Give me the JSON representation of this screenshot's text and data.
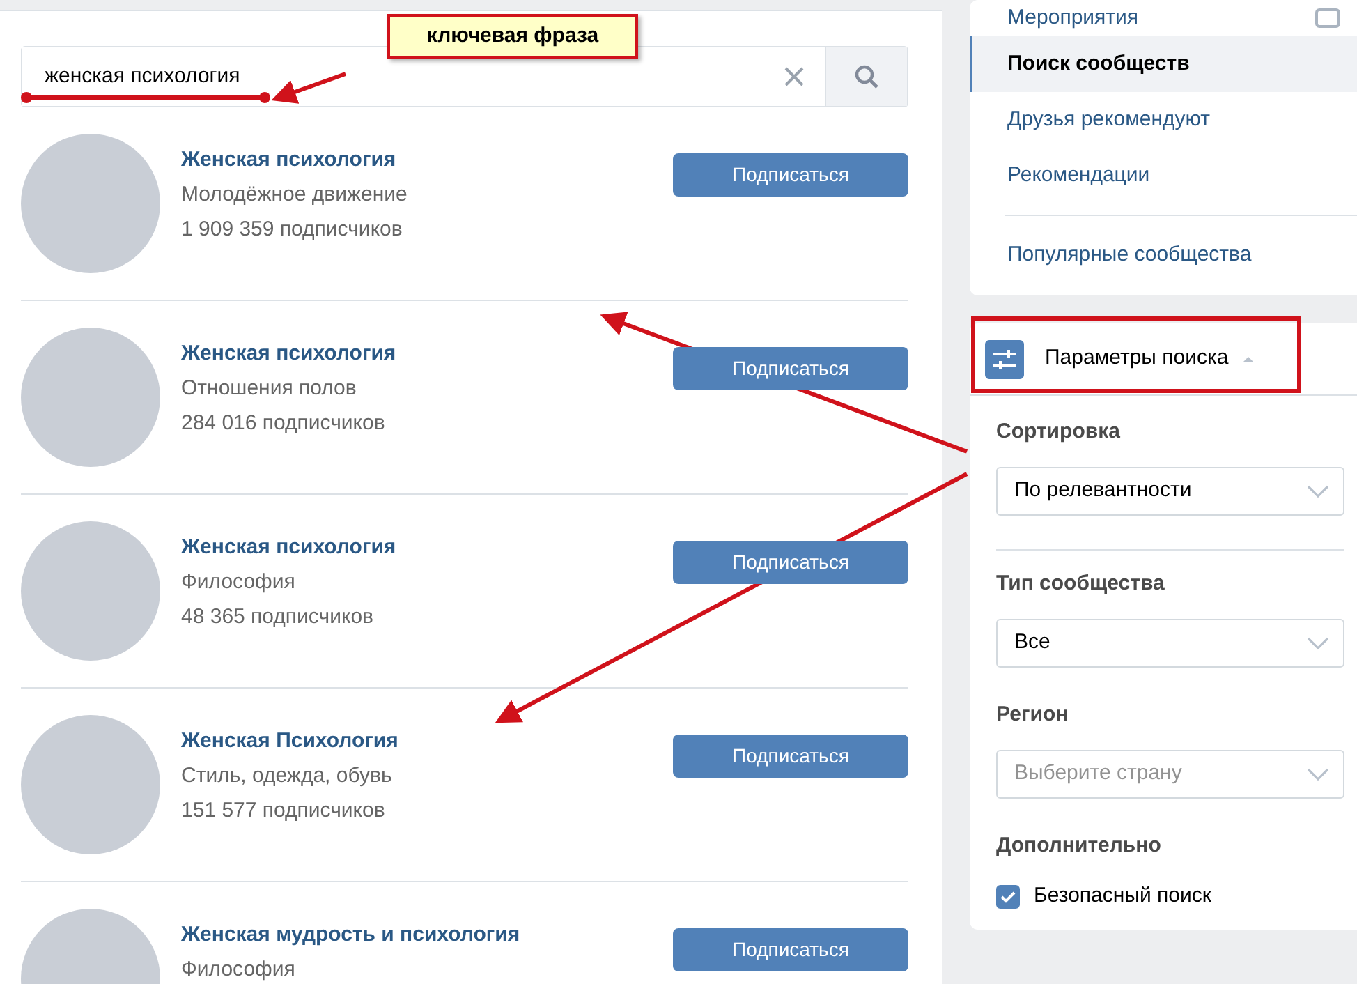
{
  "search": {
    "value": "женская психология"
  },
  "annotation": {
    "callout": "ключевая фраза"
  },
  "communities": [
    {
      "name": "Женская психология",
      "category": "Молодёжное движение",
      "subscribers": "1 909 359 подписчиков",
      "button": "Подписаться"
    },
    {
      "name": "Женская психология",
      "category": "Отношения полов",
      "subscribers": "284 016 подписчиков",
      "button": "Подписаться"
    },
    {
      "name": "Женская психология",
      "category": "Философия",
      "subscribers": "48 365 подписчиков",
      "button": "Подписаться"
    },
    {
      "name": "Женская Психология",
      "category": "Стиль, одежда, обувь",
      "subscribers": "151 577 подписчиков",
      "button": "Подписаться"
    },
    {
      "name": "Женская мудрость и психология",
      "category": "Философия",
      "button": "Подписаться"
    }
  ],
  "menu": [
    {
      "items": [
        {
          "label": "Мероприятия",
          "selected": false
        },
        {
          "label": "Поиск сообществ",
          "selected": true
        },
        {
          "label": "Друзья рекомендуют",
          "selected": false
        },
        {
          "label": "Рекомендации",
          "selected": false
        }
      ]
    },
    {
      "items": [
        {
          "label": "Популярные сообщества",
          "selected": false
        }
      ]
    }
  ],
  "search_params": {
    "title": "Параметры поиска",
    "expanded": true,
    "sections": [
      {
        "kind": "select",
        "label": "Сортировка",
        "value": "По релевантности"
      },
      {
        "kind": "select",
        "label": "Тип сообщества",
        "value": "Все"
      },
      {
        "kind": "select",
        "label": "Регион",
        "placeholder": "Выберите страну"
      },
      {
        "kind": "checkbox",
        "label": "Дополнительно",
        "option": "Безопасный поиск",
        "checked": true
      }
    ]
  }
}
